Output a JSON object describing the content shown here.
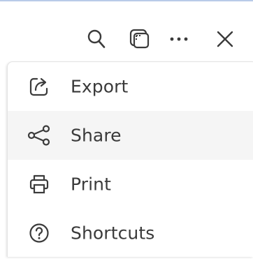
{
  "toolbar": {
    "icons": [
      "search-icon",
      "copy-icon",
      "more-icon",
      "close-icon"
    ]
  },
  "menu": {
    "items": [
      {
        "label": "Export",
        "icon": "export-icon"
      },
      {
        "label": "Share",
        "icon": "share-icon",
        "hovered": true
      },
      {
        "label": "Print",
        "icon": "printer-icon"
      },
      {
        "label": "Shortcuts",
        "icon": "help-icon"
      }
    ]
  },
  "colors": {
    "accent_border": "#b9cbe8",
    "hover_bg": "#f5f5f5",
    "text": "#3a3a3a",
    "icon": "#3b3b3b"
  }
}
